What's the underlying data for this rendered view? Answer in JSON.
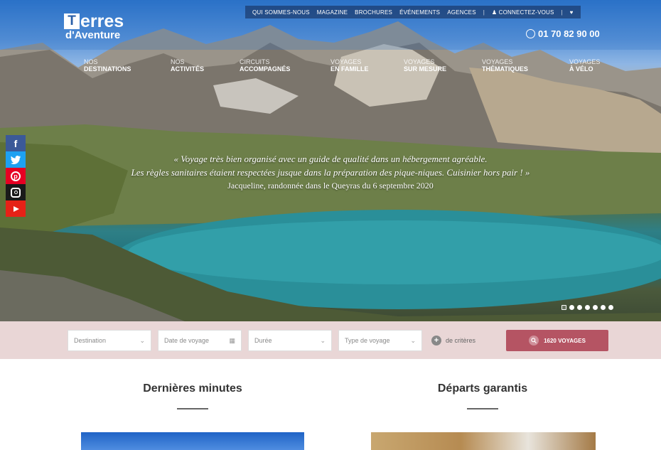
{
  "topbar": {
    "items": [
      "QUI SOMMES-NOUS",
      "MAGAZINE",
      "BROCHURES",
      "ÉVÉNEMENTS",
      "AGENCES"
    ],
    "login": "CONNECTEZ-VOUS"
  },
  "logo": {
    "line1": "Terres",
    "line2": "d'Aventure"
  },
  "phone": "01 70 82 90 00",
  "nav": [
    {
      "a": "NOS",
      "b": "DESTINATIONS"
    },
    {
      "a": "NOS",
      "b": "ACTIVITÉS"
    },
    {
      "a": "CIRCUITS",
      "b": "ACCOMPAGNÉS"
    },
    {
      "a": "VOYAGES",
      "b": "EN FAMILLE"
    },
    {
      "a": "VOYAGES",
      "b": "SUR MESURE"
    },
    {
      "a": "VOYAGES",
      "b": "THÉMATIQUES"
    },
    {
      "a": "VOYAGES",
      "b": "À VÉLO"
    }
  ],
  "social": [
    "facebook-icon",
    "twitter-icon",
    "pinterest-icon",
    "instagram-icon",
    "youtube-icon"
  ],
  "quote": {
    "line1": "« Voyage très bien organisé avec un guide de qualité dans un hébergement agréable.",
    "line2": "Les règles sanitaires étaient respectées jusque dans la préparation des pique-niques. Cuisinier hors pair ! »",
    "author": "Jacqueline, randonnée dans le Queyras du 6 septembre 2020"
  },
  "search": {
    "destination": "Destination",
    "date": "Date de voyage",
    "duree": "Durée",
    "type": "Type de voyage",
    "criteria": "de critères",
    "button": "1620 VOYAGES"
  },
  "sections": {
    "left": "Dernières minutes",
    "right": "Départs garantis"
  },
  "colors": {
    "accent": "#b55463",
    "search_bg": "#e9d6d6"
  }
}
